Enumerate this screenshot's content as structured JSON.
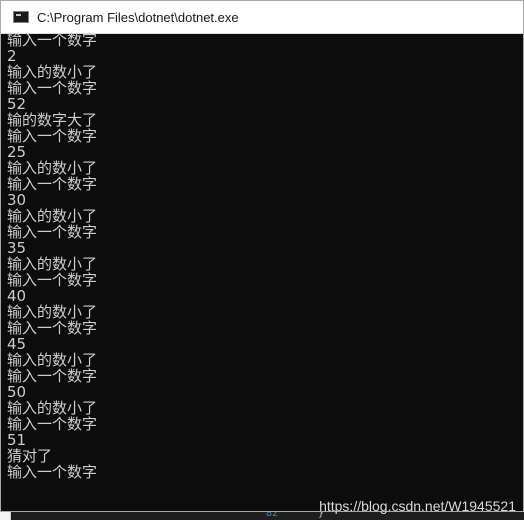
{
  "window": {
    "title": "C:\\Program Files\\dotnet\\dotnet.exe"
  },
  "console": {
    "lines": [
      "输入一个数字",
      "2",
      "输入的数小了",
      "输入一个数字",
      "52",
      "输的数字大了",
      "输入一个数字",
      "25",
      "输入的数小了",
      "输入一个数字",
      "30",
      "输入的数小了",
      "输入一个数字",
      "35",
      "输入的数小了",
      "输入一个数字",
      "40",
      "输入的数小了",
      "输入一个数字",
      "45",
      "输入的数小了",
      "输入一个数字",
      "50",
      "输入的数小了",
      "输入一个数字",
      "51",
      "猜对了",
      "输入一个数字"
    ]
  },
  "watermark": "https://blog.csdn.net/W1945521",
  "background_editor": {
    "line_number": "82",
    "code": "}"
  },
  "colors": {
    "console_bg": "#0c0c0c",
    "console_text": "#cccccc",
    "titlebar_bg": "#ffffff"
  }
}
